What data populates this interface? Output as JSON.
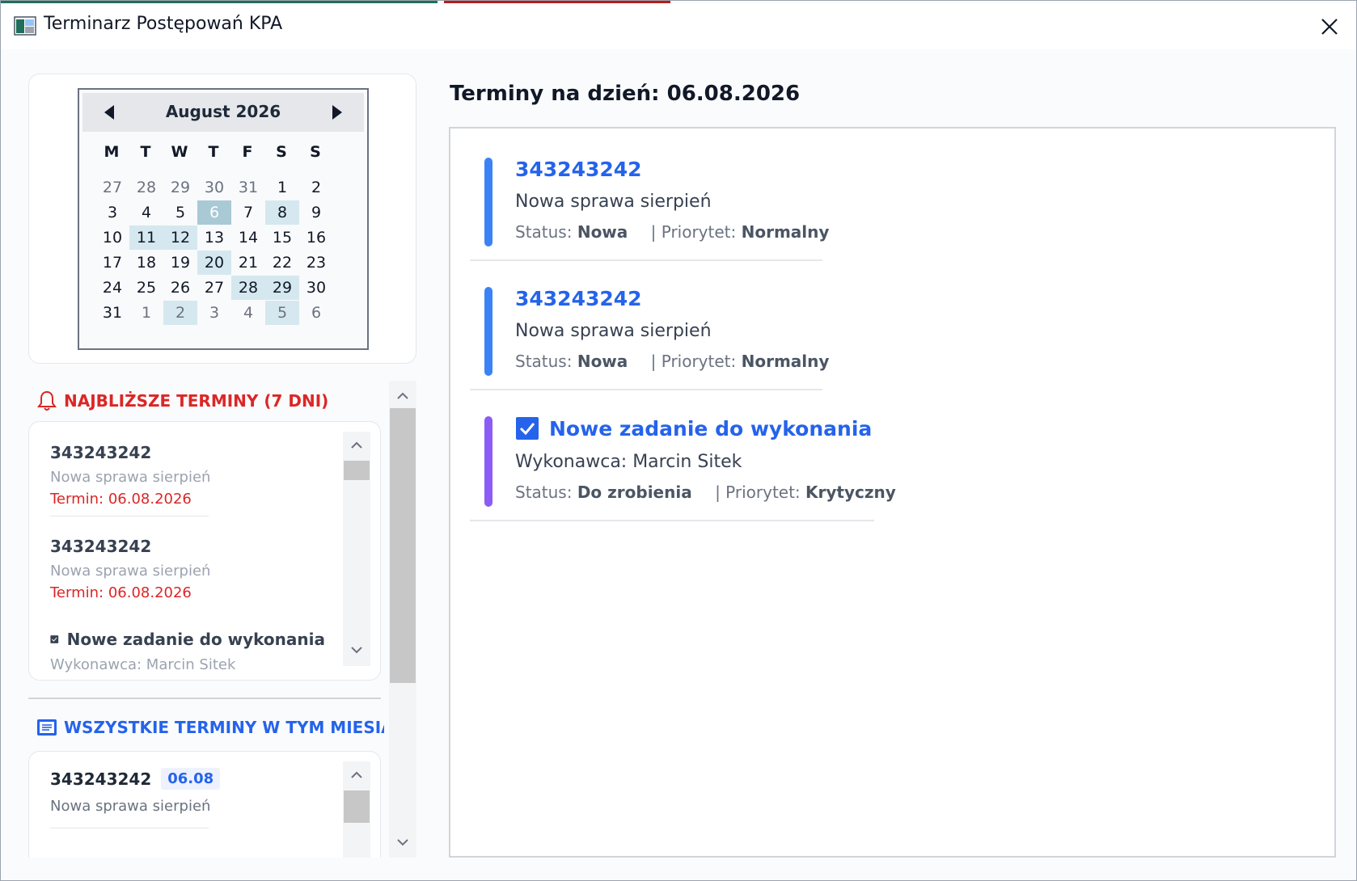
{
  "window": {
    "title": "Terminarz Postępowań KPA",
    "app_icon": "app-window-icon",
    "close_icon": "close-icon"
  },
  "calendar": {
    "month_label": "August 2026",
    "prev_icon": "triangle-left-icon",
    "next_icon": "triangle-right-icon",
    "weekdays": [
      "M",
      "T",
      "W",
      "T",
      "F",
      "S",
      "S"
    ],
    "weeks": [
      [
        "27",
        "28",
        "29",
        "30",
        "31",
        "1",
        "2"
      ],
      [
        "3",
        "4",
        "5",
        "6",
        "7",
        "8",
        "9"
      ],
      [
        "10",
        "11",
        "12",
        "13",
        "14",
        "15",
        "16"
      ],
      [
        "17",
        "18",
        "19",
        "20",
        "21",
        "22",
        "23"
      ],
      [
        "24",
        "25",
        "26",
        "27",
        "28",
        "29",
        "30"
      ],
      [
        "31",
        "1",
        "2",
        "3",
        "4",
        "5",
        "6"
      ]
    ],
    "selected_day": "6",
    "event_days": [
      "8",
      "11",
      "12",
      "20",
      "28",
      "29",
      "2 (next month)",
      "5 (next month)"
    ],
    "colors": {
      "event_day": "#d5e8ef",
      "selected_day": "#a9c9d5"
    }
  },
  "upcoming": {
    "icon": "bell-icon",
    "title": "NAJBLIŻSZE TERMINY (7 DNI)",
    "items": [
      {
        "title": "343243242",
        "subtitle": "Nowa sprawa sierpień",
        "deadline": "Termin: 06.08.2026"
      },
      {
        "title": "343243242",
        "subtitle": "Nowa sprawa sierpień",
        "deadline": "Termin: 06.08.2026"
      }
    ],
    "task": {
      "icon": "checkbox-checked-icon",
      "title": "Nowe zadanie do wykonania",
      "subtitle": "Wykonawca: Marcin Sitek"
    }
  },
  "month_list": {
    "icon": "list-icon",
    "title": "WSZYSTKIE TERMINY W TYM MIESIĄCU",
    "items": [
      {
        "title": "343243242",
        "date": "06.08",
        "subtitle": "Nowa sprawa sierpień"
      }
    ]
  },
  "day_view": {
    "heading": "Terminy na dzień: 06.08.2026",
    "status_label": "Status:",
    "priority_label": "| Priorytet:",
    "entries": [
      {
        "kind": "case",
        "title": "343243242",
        "description": "Nowa sprawa sierpień",
        "status": "Nowa",
        "priority": "Normalny",
        "bar_color": "#3b82f6"
      },
      {
        "kind": "case",
        "title": "343243242",
        "description": "Nowa sprawa sierpień",
        "status": "Nowa",
        "priority": "Normalny",
        "bar_color": "#3b82f6"
      },
      {
        "kind": "task",
        "icon": "checkbox-checked-icon",
        "title": "Nowe zadanie do wykonania",
        "description": "Wykonawca: Marcin Sitek",
        "status": "Do zrobienia",
        "priority": "Krytyczny",
        "bar_color": "#8b5cf6"
      }
    ]
  },
  "colors": {
    "accent_blue": "#2563eb",
    "alert_red": "#dc2626",
    "task_purple": "#8b5cf6"
  }
}
